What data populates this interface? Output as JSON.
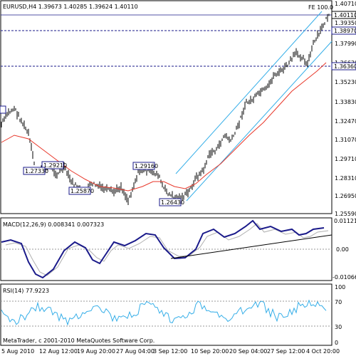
{
  "main": {
    "symbol_header": "EURUSD,H4  1.39673 1.40285 1.39624 1.40110",
    "fe_label": "FE 100.0",
    "price_axis": [
      "1.40710",
      "1.39350",
      "1.37990",
      "1.36630",
      "1.35230",
      "1.33830",
      "1.32470",
      "1.31070",
      "1.29710",
      "1.28310",
      "1.26950",
      "1.25590"
    ],
    "current_price": "1.40110",
    "level_high": "1.38970",
    "level_low": "1.36360",
    "swing_labels": [
      "1.29210",
      "1.27330",
      "1.25870",
      "1.29160",
      "1.26430"
    ]
  },
  "macd": {
    "title": "MACD(12,26,9) 0.008341 0.007323",
    "axis": [
      "0.011216",
      "0.00",
      "-0.01066"
    ]
  },
  "rsi": {
    "title": "RSI(14) 77.9223",
    "axis": [
      "100",
      "70",
      "30",
      "0"
    ]
  },
  "footer": {
    "copyright": "MetaTrader, c 2001-2010 MetaQuotes Software Corp."
  },
  "time_axis": [
    "5 Aug 2010",
    "12 Aug 12:00",
    "19 Aug 20:00",
    "27 Aug 04:00",
    "3 Sep 12:00",
    "10 Sep 20:00",
    "20 Sep 04:00",
    "27 Sep 12:00",
    "4 Oct 20:00"
  ],
  "colors": {
    "price_bars": "#000000",
    "ma_line": "#e8372a",
    "channel": "#35aee8",
    "level_line": "#1a1a8a",
    "macd_main": "#1a1a8a",
    "macd_signal": "#b0b0b0",
    "rsi_line": "#35aee8",
    "trendline": "#000000"
  }
}
